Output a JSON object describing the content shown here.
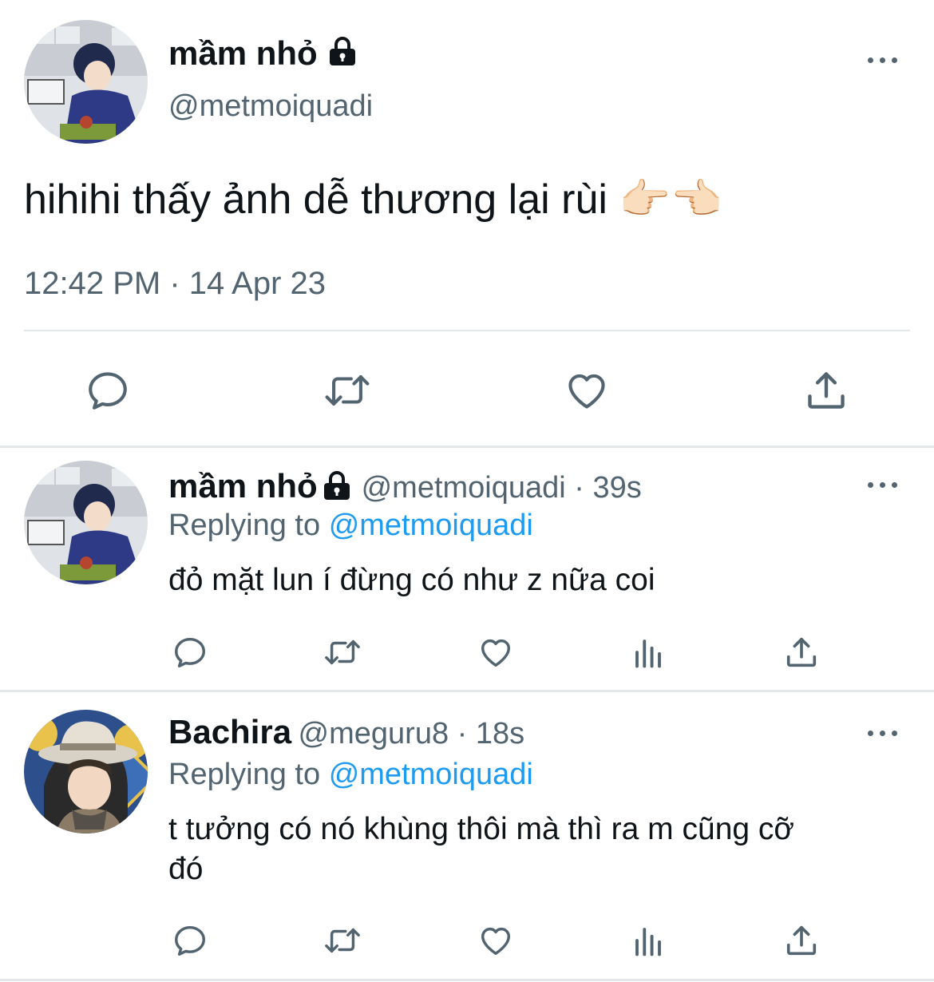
{
  "main_tweet": {
    "display_name": "mầm nhỏ",
    "handle": "@metmoiquadi",
    "text": "hihihi thấy ảnh dễ thương lại rùi 👉🏻👈🏻",
    "timestamp": "12:42 PM · 14 Apr 23",
    "actions": [
      "reply-icon",
      "retweet-icon",
      "like-icon",
      "share-icon"
    ]
  },
  "replies": [
    {
      "display_name": "mầm nhỏ",
      "handle_time": "@metmoiquadi · 39s",
      "replying_prefix": "Replying to",
      "replying_to": "@metmoiquadi",
      "text": "đỏ mặt lun í đừng có như z nữa coi",
      "actions": [
        "reply-icon",
        "retweet-icon",
        "like-icon",
        "views-icon",
        "share-icon"
      ]
    },
    {
      "display_name": "Bachira",
      "handle_time": "@meguru8 · 18s",
      "replying_prefix": "Replying to",
      "replying_to": "@metmoiquadi",
      "text_line1": "t tưởng có nó khùng thôi mà thì ra m cũng cỡ",
      "text_line2": "đó",
      "actions": [
        "reply-icon",
        "retweet-icon",
        "like-icon",
        "views-icon",
        "share-icon"
      ]
    }
  ],
  "colors": {
    "text": "#0f1419",
    "secondary": "#536471",
    "link": "#1d9bf0",
    "divider": "#e4e8eb"
  }
}
